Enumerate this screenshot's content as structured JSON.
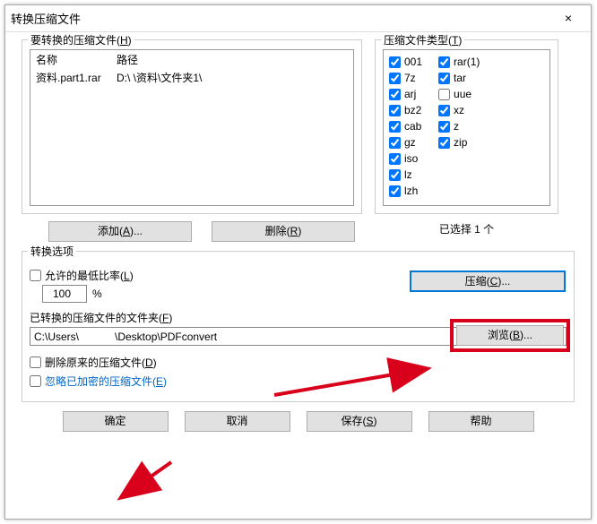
{
  "title": "转换压缩文件",
  "close": "×",
  "fileset_legend_pre": "要转换的压缩文件(",
  "fileset_legend_u": "H",
  "fileset_legend_post": ")",
  "col_name": "名称",
  "col_path": "路径",
  "files": [
    {
      "name": "资料.part1.rar",
      "path": "D:\\          \\资料\\文件夹1\\"
    }
  ],
  "add_label_pre": "添加(",
  "add_label_u": "A",
  "add_label_post": ")...",
  "del_label_pre": "删除(",
  "del_label_u": "R",
  "del_label_post": ")",
  "types_legend_pre": "压缩文件类型(",
  "types_legend_u": "T",
  "types_legend_post": ")",
  "types": [
    "001",
    "7z",
    "arj",
    "bz2",
    "cab",
    "gz",
    "iso",
    "lz",
    "lzh",
    "rar(1)",
    "tar",
    "uue",
    "xz",
    "z",
    "zip"
  ],
  "types_checked": {
    "001": true,
    "7z": true,
    "arj": true,
    "bz2": true,
    "cab": true,
    "gz": true,
    "iso": true,
    "lz": true,
    "lzh": true,
    "rar(1)": true,
    "tar": true,
    "uue": false,
    "xz": true,
    "z": true,
    "zip": true
  },
  "selected_count": "已选择 1 个",
  "opts_legend": "转换选项",
  "minrate_label_pre": "允许的最低比率(",
  "minrate_label_u": "L",
  "minrate_label_post": ")",
  "minrate_value": "100",
  "minrate_pct": "%",
  "compress_pre": "压缩(",
  "compress_u": "C",
  "compress_post": ")...",
  "folder_label_pre": "已转换的压缩文件的文件夹(",
  "folder_label_u": "F",
  "folder_label_post": ")",
  "browse_pre": "浏览(",
  "browse_u": "B",
  "browse_post": ")...",
  "folder_value": "C:\\Users\\            \\Desktop\\PDFconvert",
  "delorig_pre": "删除原来的压缩文件(",
  "delorig_u": "D",
  "delorig_post": ")",
  "skipenc_pre": "忽略已加密的压缩文件(",
  "skipenc_u": "E",
  "skipenc_post": ")",
  "ok": "确定",
  "cancel": "取消",
  "save_pre": "保存(",
  "save_u": "S",
  "save_post": ")",
  "help": "帮助"
}
